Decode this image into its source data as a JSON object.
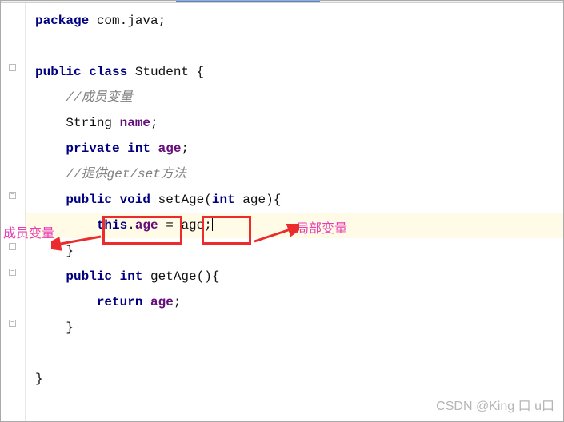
{
  "code": {
    "line1": {
      "kw1": "package",
      "pkg": " com.java",
      "semi": ";"
    },
    "line3": {
      "kw_public": "public",
      "kw_class": " class",
      "classname": " Student ",
      "brace": "{"
    },
    "line4": {
      "comment": "//成员变量"
    },
    "line5": {
      "type": "String ",
      "name": "name",
      "semi": ";"
    },
    "line6": {
      "kw_private": "private",
      "kw_int": " int",
      "name": " age",
      "semi": ";"
    },
    "line7": {
      "comment": "//提供get/set方法"
    },
    "line8": {
      "kw_public": "public",
      "kw_void": " void",
      "method": " setAge",
      "paren_o": "(",
      "kw_int": "int",
      "param": " age",
      "paren_c": ")",
      "brace": "{"
    },
    "line9": {
      "kw_this": "this",
      "dot": ".",
      "field": "age",
      "eq": " = ",
      "var": "age",
      "semi": ";"
    },
    "line10": {
      "brace": "}"
    },
    "line11": {
      "kw_public": "public",
      "kw_int": " int",
      "method": " getAge",
      "parens": "()",
      "brace": "{"
    },
    "line12": {
      "kw_return": "return",
      "field": " age",
      "semi": ";"
    },
    "line13": {
      "brace": "}"
    },
    "line15": {
      "brace": "}"
    }
  },
  "annotations": {
    "member_var": "成员变量",
    "local_var": "局部变量"
  },
  "watermark": "CSDN @King 口 u口"
}
